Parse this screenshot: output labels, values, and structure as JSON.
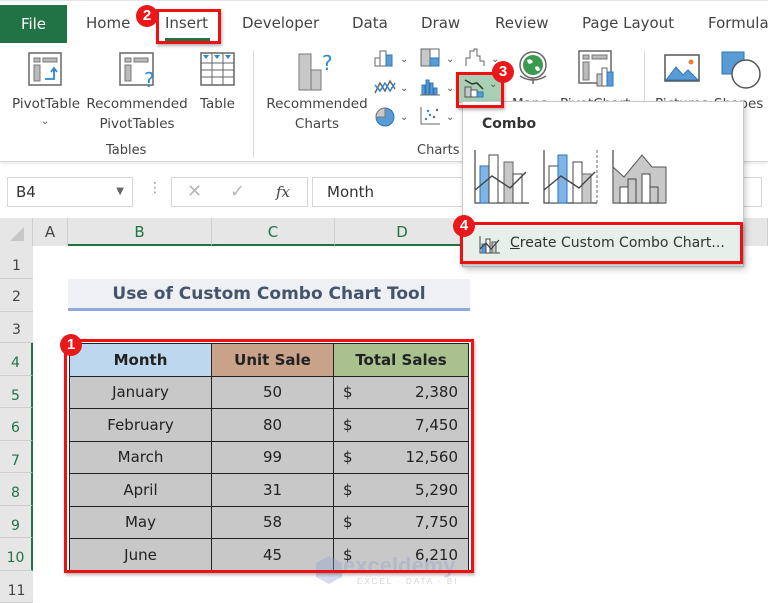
{
  "ribbon_tabs": {
    "file": "File",
    "home": "Home",
    "insert": "Insert",
    "developer": "Developer",
    "data": "Data",
    "draw": "Draw",
    "review": "Review",
    "page_layout": "Page Layout",
    "formulas": "Formula"
  },
  "ribbon": {
    "tables_group": {
      "label": "Tables",
      "pivottable": "PivotTable",
      "recommended_pivottables_1": "Recommended",
      "recommended_pivottables_2": "PivotTables",
      "table": "Table"
    },
    "charts_group": {
      "label": "Charts",
      "recommended_charts_1": "Recommended",
      "recommended_charts_2": "Charts",
      "maps": "Maps",
      "pivotchart": "PivotChart"
    },
    "illustrations": {
      "pictures": "Pictures",
      "shapes": "Shapes"
    }
  },
  "formula_bar": {
    "name_box": "B4",
    "content": "Month",
    "cancel_icon": "✕",
    "enter_icon": "✓",
    "fx_label": "fx"
  },
  "grid": {
    "columns": [
      "A",
      "B",
      "C",
      "D"
    ],
    "rows": [
      "1",
      "2",
      "3",
      "4",
      "5",
      "6",
      "7",
      "8",
      "9",
      "10",
      "11"
    ]
  },
  "sheet": {
    "title": "Use of Custom Combo Chart Tool",
    "headers": {
      "month": "Month",
      "unit_sale": "Unit Sale",
      "total_sales": "Total Sales"
    },
    "header_colors": {
      "month": "#bdd7ee",
      "unit_sale": "#c9a28a",
      "total_sales": "#a9c08f"
    },
    "rows": [
      {
        "month": "January",
        "unit_sale": "50",
        "currency": "$",
        "total_sales": "2,380"
      },
      {
        "month": "February",
        "unit_sale": "80",
        "currency": "$",
        "total_sales": "7,450"
      },
      {
        "month": "March",
        "unit_sale": "99",
        "currency": "$",
        "total_sales": "12,560"
      },
      {
        "month": "April",
        "unit_sale": "31",
        "currency": "$",
        "total_sales": "5,290"
      },
      {
        "month": "May",
        "unit_sale": "58",
        "currency": "$",
        "total_sales": "7,750"
      },
      {
        "month": "June",
        "unit_sale": "45",
        "currency": "$",
        "total_sales": "6,210"
      }
    ]
  },
  "combo_dropdown": {
    "title": "Combo",
    "item_label_first": "C",
    "item_label_rest": "reate Custom Combo Chart..."
  },
  "annotations": {
    "badge1": "1",
    "badge2": "2",
    "badge3": "3",
    "badge4": "4"
  },
  "watermark": {
    "name": "exceldemy",
    "tagline": "EXCEL · DATA · BI"
  },
  "colors": {
    "excel_green": "#217346",
    "annotation_red": "#ee1111"
  }
}
